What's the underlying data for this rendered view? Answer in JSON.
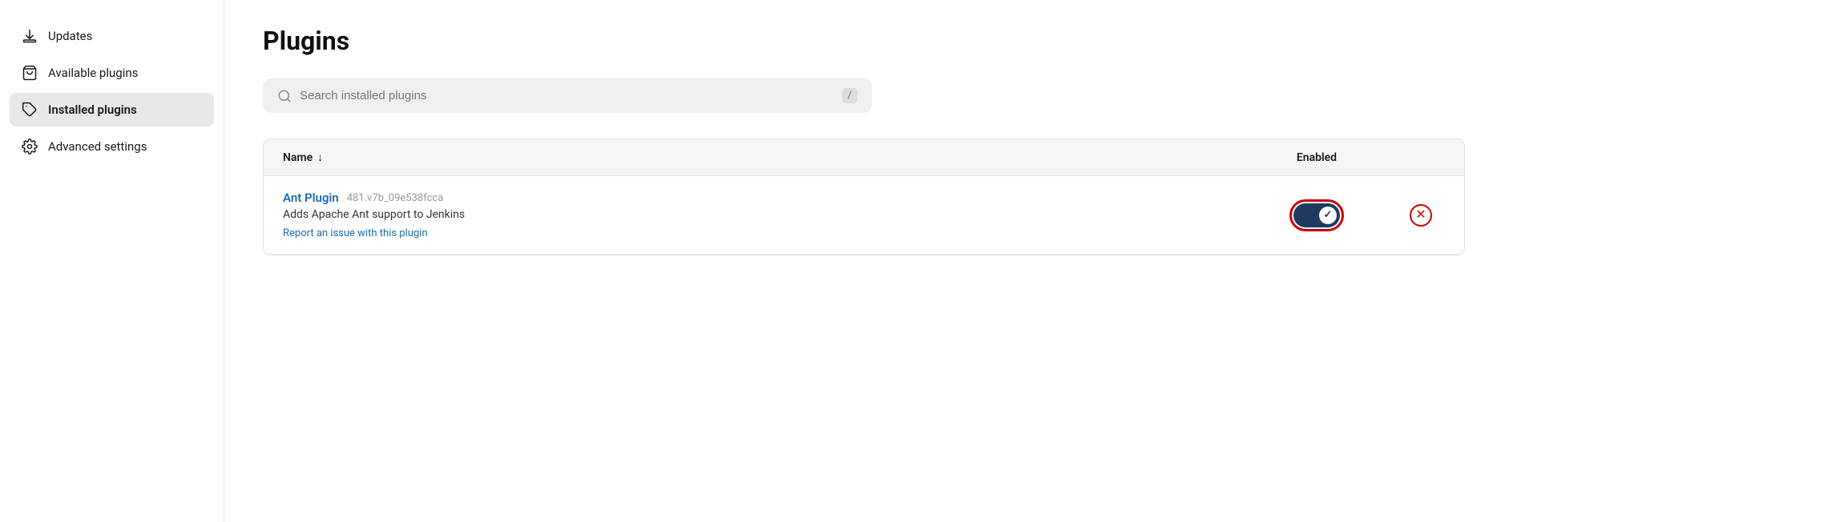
{
  "sidebar": {
    "items": [
      {
        "id": "updates",
        "label": "Updates",
        "icon": "download-icon",
        "active": false
      },
      {
        "id": "available-plugins",
        "label": "Available plugins",
        "icon": "bag-icon",
        "active": false
      },
      {
        "id": "installed-plugins",
        "label": "Installed plugins",
        "icon": "puzzle-icon",
        "active": true
      },
      {
        "id": "advanced-settings",
        "label": "Advanced settings",
        "icon": "gear-icon",
        "active": false
      }
    ]
  },
  "main": {
    "title": "Plugins",
    "search": {
      "placeholder": "Search installed plugins",
      "shortcut": "/"
    },
    "table": {
      "col_name": "Name",
      "col_name_sort": "↓",
      "col_enabled": "Enabled",
      "rows": [
        {
          "name": "Ant Plugin",
          "version": "481.v7b_09e538fcca",
          "description": "Adds Apache Ant support to Jenkins",
          "report_link": "Report an issue with this plugin",
          "enabled": true
        }
      ]
    }
  }
}
